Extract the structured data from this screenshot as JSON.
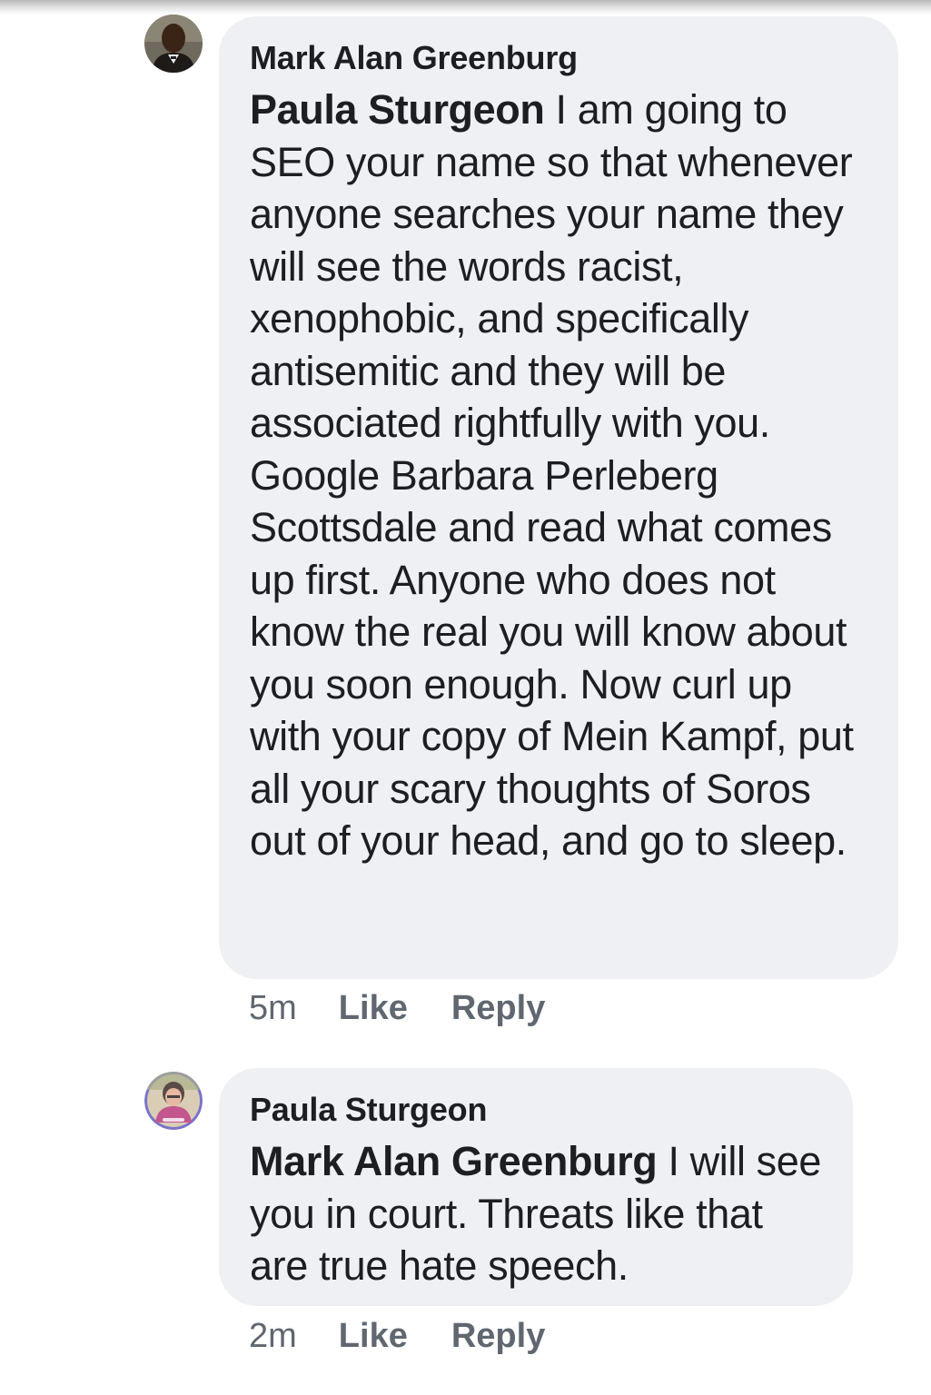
{
  "comments": [
    {
      "author": "Mark Alan Greenburg",
      "avatar_icon": "profile-photo-icon",
      "mention": "Paula Sturgeon",
      "text": " I am going to SEO your name so that whenever anyone searches your name they will see the words racist, xenophobic, and specifically antisemitic and they will be associated rightfully with you.  Google Barbara Perleberg Scottsdale and read what comes up first. Anyone who does not know the real you will know about you soon enough.  Now curl up with your copy of Mein Kampf, put all your scary thoughts of Soros out of your head, and go to sleep.",
      "time": "5m",
      "like_label": "Like",
      "reply_label": "Reply"
    },
    {
      "author": "Paula Sturgeon",
      "avatar_icon": "profile-photo-icon",
      "mention": "Mark Alan Greenburg",
      "text": " I will see you in court. Threats like that are true hate speech.",
      "time": "2m",
      "like_label": "Like",
      "reply_label": "Reply"
    }
  ],
  "colors": {
    "bubble": "#eff0f3",
    "text": "#1c1e21",
    "meta": "#606770"
  }
}
